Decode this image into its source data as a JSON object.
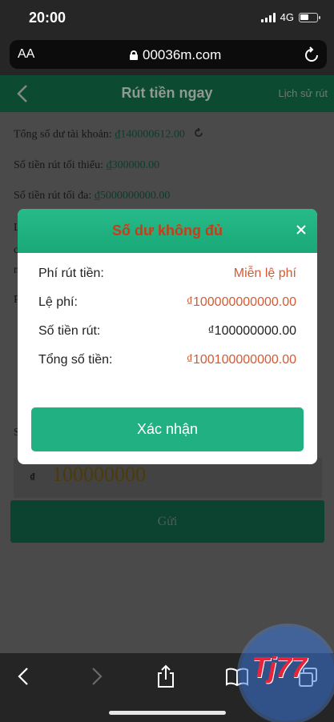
{
  "status_bar": {
    "time": "20:00",
    "network": "4G",
    "battery_level": 0.55
  },
  "browser": {
    "text_size_label": "AA",
    "url": "00036m.com"
  },
  "header": {
    "title": "Rút tiền ngay",
    "history_link": "Lịch sử rút"
  },
  "info": {
    "balance_label": "Tổng số dư tài khoản:",
    "balance_value": "₫140000612.00",
    "min_label": "Số tiền rút tối thiểu:",
    "min_value": "₫300000.00",
    "max_label": "Số tiền rút tối đa:",
    "max_value": "₫5000000000.00"
  },
  "background_fragments": {
    "f1": "L",
    "f2": "c",
    "f3": "n",
    "f4": "P",
    "f5": "S"
  },
  "amount_input": {
    "currency": "₫",
    "value": "100000000"
  },
  "submit_label": "Gửi",
  "modal": {
    "title": "Số dư không đủ",
    "rows": [
      {
        "label": "Phí rút tiền:",
        "value": "Miễn lệ phí"
      },
      {
        "label": "Lệ phí:",
        "value": "₫100000000000.00"
      },
      {
        "label": "Số tiền rút:",
        "value": "₫100000000.00"
      },
      {
        "label": "Tổng số tiền:",
        "value": "₫100100000000.00"
      }
    ],
    "confirm_label": "Xác nhận"
  },
  "icons": {
    "back": "chevron-left-icon",
    "forward": "chevron-right-icon",
    "share": "share-icon",
    "bookmarks": "book-icon",
    "tabs": "tabs-icon",
    "lock": "lock-icon",
    "reload": "reload-icon",
    "close": "close-icon",
    "refresh": "refresh-icon"
  },
  "colors": {
    "accent_green": "#21b082",
    "alert_red": "#cc3b17",
    "value_red": "#d35a33"
  },
  "watermark": {
    "logo_text": "Tj77"
  }
}
